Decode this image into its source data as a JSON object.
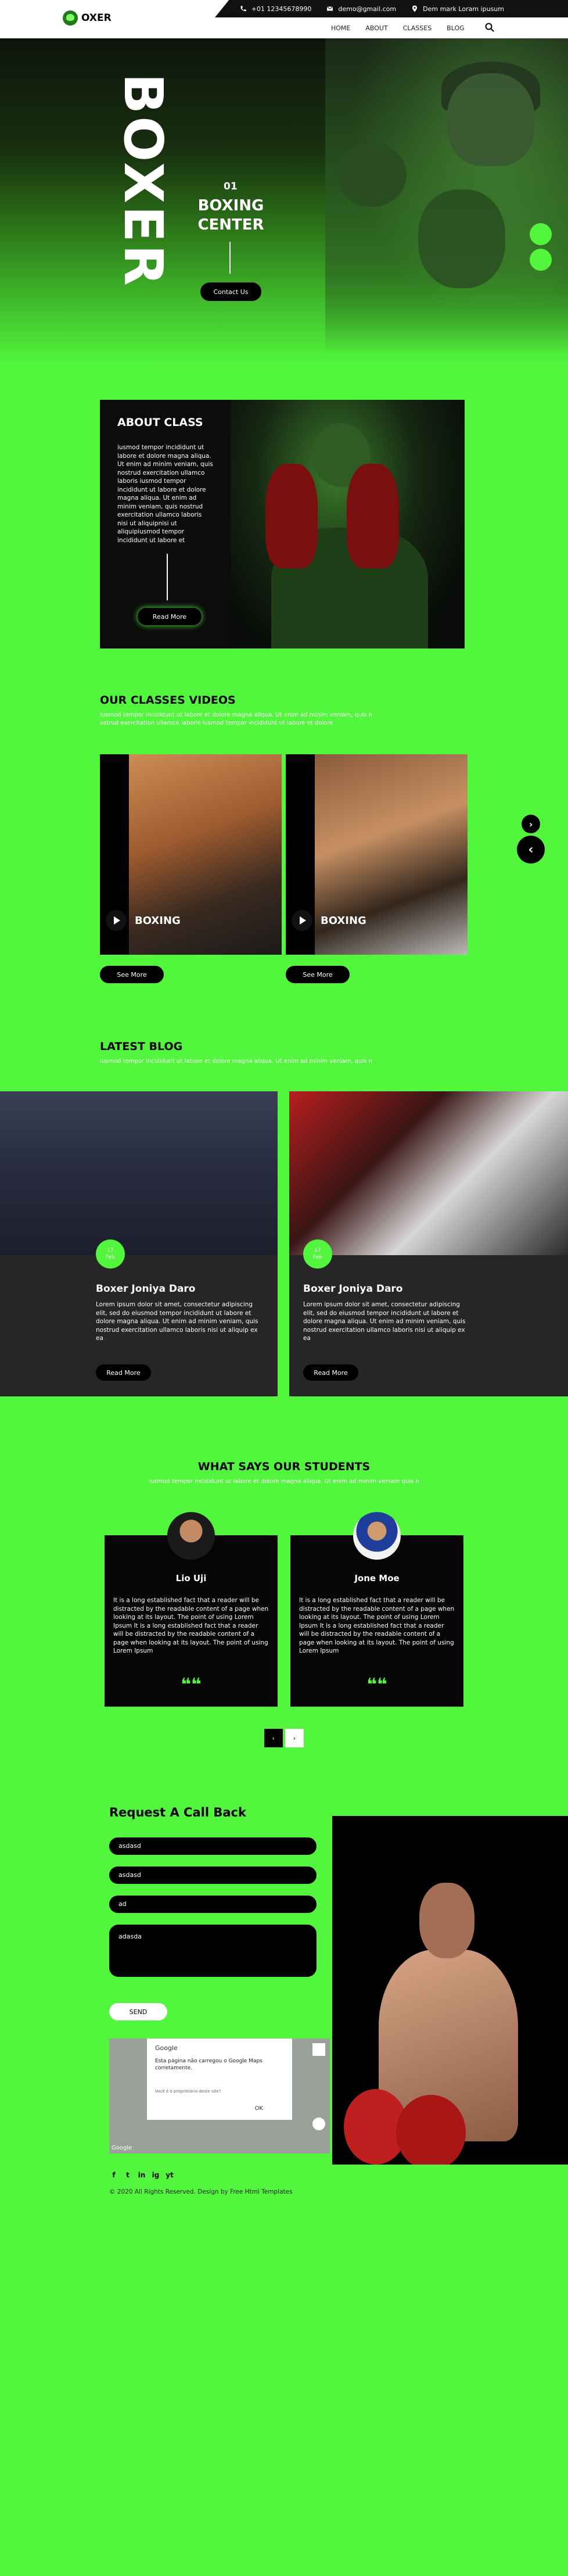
{
  "topbar": {
    "phone": "+01 12345678990",
    "email": "demo@gmail.com",
    "address": "Dem mark Loram ipusum"
  },
  "logo": {
    "text": "OXER"
  },
  "nav": {
    "items": [
      "HOME",
      "ABOUT",
      "CLASSES",
      "BLOG"
    ]
  },
  "hero": {
    "big_word": "BOXER",
    "number": "01",
    "title_line1": "BOXING",
    "title_line2": "CENTER",
    "button": "Contact Us"
  },
  "about": {
    "title": "ABOUT CLASS",
    "text": "iusmod tempor incididunt ut labore et dolore magna aliqua. Ut enim ad minim veniam, quis nostrud exercitation ullamco laboris iusmod tempor incididunt ut labore et dolore magna aliqua. Ut enim ad minim veniam, quis nostrud exercitation ullamco laboris nisi ut aliquipnisi ut aliquipiusmod tempor incididunt ut labore et",
    "button": "Read More"
  },
  "classes": {
    "title": "OUR CLASSES VIDEOS",
    "subtitle": "iusmod tempor incididunt ut labore et dolore magna aliqua. Ut enim ad minim veniam, quis n ostrud exercitation ullamco laboris iusmod tempor incididunt ut labore et dolore",
    "videos": [
      {
        "label": "BOXING",
        "button": "See More"
      },
      {
        "label": "BOXING",
        "button": "See More"
      }
    ],
    "next_arrow": "›",
    "prev_arrow": "‹"
  },
  "blog": {
    "title": "LATEST BLOG",
    "subtitle": "iusmod tempor incididunt ut labore et dolore magna aliqua. Ut enim ad minim veniam, quis n",
    "posts": [
      {
        "day": "17",
        "month": "Feb",
        "title": "Boxer Joniya Daro",
        "text": "Lorem ipsum dolor sit amet, consectetur adipiscing elit, sed do eiusmod tempor incididunt ut labore et dolore magna aliqua. Ut enim ad minim veniam, quis nostrud exercitation ullamco laboris nisi ut aliquip ex ea",
        "button": "Read More"
      },
      {
        "day": "17",
        "month": "Feb",
        "title": "Boxer Joniya Daro",
        "text": "Lorem ipsum dolor sit amet, consectetur adipiscing elit, sed do eiusmod tempor incididunt ut labore et dolore magna aliqua. Ut enim ad minim veniam, quis nostrud exercitation ullamco laboris nisi ut aliquip ex ea",
        "button": "Read More"
      }
    ]
  },
  "testimonials": {
    "title": "WHAT SAYS OUR STUDENTS",
    "subtitle": "iusmod tempor incididunt ut labore et dolore magna aliqua. Ut enim ad minim veniam quis n",
    "items": [
      {
        "name": "Lio Uji",
        "text": "It is a long established fact that a reader will be distracted by the readable content of a page when looking at its layout. The point of using Lorem Ipsum It is a long established fact that a reader will be distracted by the readable content of a page when looking at its layout. The point of using Lorem Ipsum"
      },
      {
        "name": "Jone Moe",
        "text": "It is a long established fact that a reader will be distracted by the readable content of a page when looking at its layout. The point of using Lorem Ipsum It is a long established fact that a reader will be distracted by the readable content of a page when looking at its layout. The point of using Lorem Ipsum"
      }
    ],
    "quote_glyph": "❝❝",
    "pager": [
      "‹",
      "›"
    ]
  },
  "callback": {
    "title": "Request A Call Back",
    "name_value": "asdasd",
    "email_value": "asdasd",
    "phone_value": "ad",
    "message_value": "adasda",
    "send": "SEND"
  },
  "map": {
    "provider": "Google",
    "message": "Esta página não carregou o Google Maps corretamente.",
    "owner_question": "Você é o proprietário deste site?",
    "ok": "OK",
    "logo": "Google"
  },
  "footer": {
    "social": [
      "f",
      "t",
      "in",
      "ig",
      "yt"
    ],
    "copyright": "© 2020 All Rights Reserved. Design by Free Html Templates"
  },
  "colors": {
    "accent": "#52f63c",
    "dark": "#0c0c0c"
  }
}
